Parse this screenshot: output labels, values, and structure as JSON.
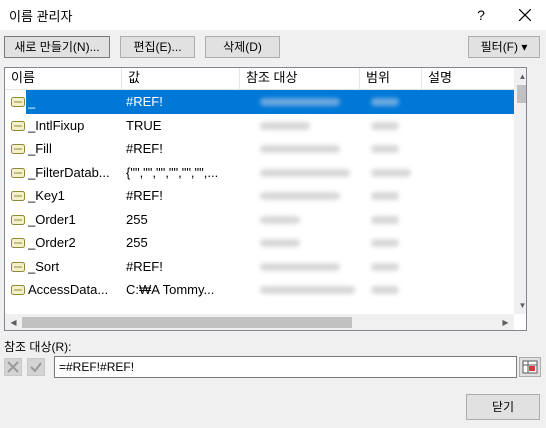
{
  "window": {
    "title": "이름 관리자",
    "help": "?"
  },
  "toolbar": {
    "new_label": "새로 만들기(N)...",
    "edit_label": "편집(E)...",
    "delete_label": "삭제(D)",
    "filter_label": "필터(F) ▾"
  },
  "columns": [
    "이름",
    "값",
    "참조 대상",
    "범위",
    "설명"
  ],
  "rows": [
    {
      "name": "_",
      "value": "#REF!"
    },
    {
      "name": "_IntlFixup",
      "value": "TRUE"
    },
    {
      "name": "_Fill",
      "value": "#REF!"
    },
    {
      "name": "_FilterDatab...",
      "value": "{\"\",\"\",\"\",\"\",\"\",\"\",..."
    },
    {
      "name": "_Key1",
      "value": "#REF!"
    },
    {
      "name": "_Order1",
      "value": "255"
    },
    {
      "name": "_Order2",
      "value": "255"
    },
    {
      "name": "_Sort",
      "value": "#REF!"
    },
    {
      "name": "AccessData...",
      "value": "C:₩A Tommy..."
    }
  ],
  "reference": {
    "label": "참조 대상(R):",
    "value": "=#REF!#REF!"
  },
  "footer": {
    "close_label": "닫기"
  },
  "colors": {
    "selection": "#0078d7",
    "background": "#f0f0f0"
  }
}
